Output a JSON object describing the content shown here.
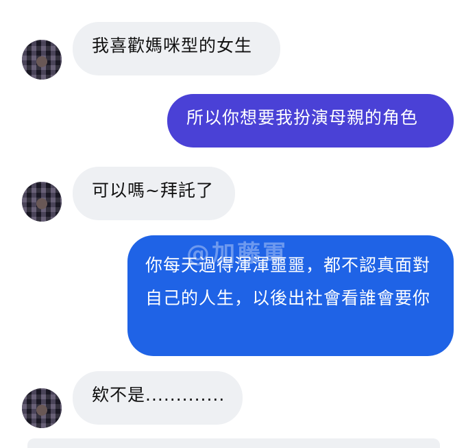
{
  "messages": [
    {
      "side": "left",
      "text": "我喜歡媽咪型的女生"
    },
    {
      "side": "right",
      "text": "所以你想要我扮演母親的角色"
    },
    {
      "side": "left",
      "text": "可以嗎~拜託了"
    },
    {
      "side": "right",
      "text": "你每天過得渾渾噩噩，都不認真面對自己的人生，以後出社會看誰會要你"
    },
    {
      "side": "left",
      "text": "欸不是............."
    }
  ],
  "watermark": {
    "text": "@加藤軍"
  },
  "colors": {
    "incoming_bubble": "#eef0f3",
    "outgoing_bubble_1": "#4a41d6",
    "outgoing_bubble_2": "#1f63e6"
  }
}
